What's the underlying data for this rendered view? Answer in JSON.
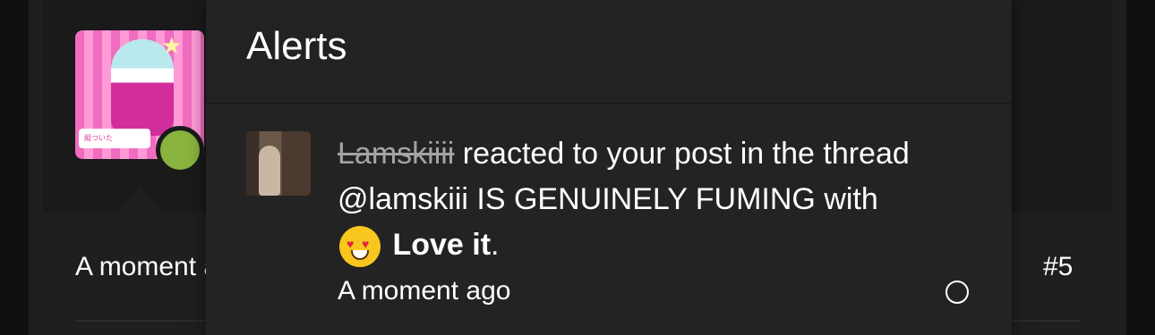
{
  "post": {
    "time": "A moment ago",
    "number": "#5",
    "avatar_caption": "縦ついた"
  },
  "alerts": {
    "title": "Alerts",
    "items": [
      {
        "username": "Lamskiiii",
        "text_before": " reacted to your post in the thread @lamskiii IS GENUINELY FUMING with ",
        "reaction": "Love it",
        "text_after": ".",
        "time": "A moment ago"
      }
    ]
  },
  "colors": {
    "online_status": "#87b33e",
    "panel_background": "#232323",
    "page_background": "#1f1f1f"
  }
}
